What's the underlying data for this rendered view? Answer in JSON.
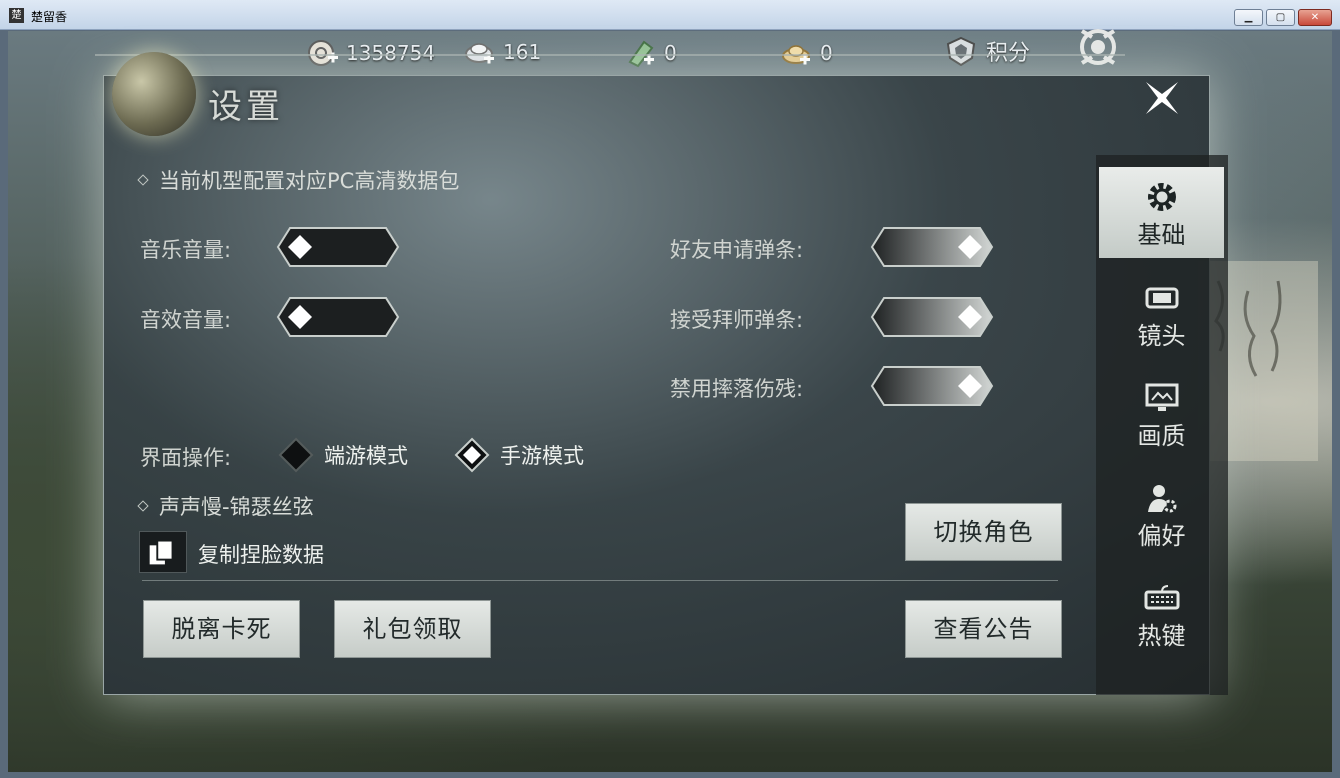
{
  "window": {
    "title": "楚留香",
    "icon_glyph": "楚",
    "min_glyph": "▁",
    "max_glyph": "▢",
    "close_glyph": "✕"
  },
  "hud": {
    "coins": "1358754",
    "silver": "161",
    "jade": "0",
    "ingot": "0",
    "points_label": "积分"
  },
  "settings": {
    "title": "设置",
    "hd_pack_label": "当前机型配置对应PC高清数据包",
    "music_volume_label": "音乐音量:",
    "sfx_volume_label": "音效音量:",
    "friend_request_label": "好友申请弹条:",
    "mentor_request_label": "接受拜师弹条:",
    "disable_fall_damage_label": "禁用摔落伤残:",
    "music_volume_level": 0,
    "sfx_volume_level": 0,
    "friend_request_enabled": true,
    "mentor_request_enabled": true,
    "disable_fall_damage_enabled": true,
    "ui_mode_label": "界面操作:",
    "ui_modes": [
      "端游模式",
      "手游模式"
    ],
    "ui_mode_selected": "手游模式",
    "character_label": "声声慢-锦瑟丝弦",
    "copy_face_label": "复制捏脸数据",
    "switch_role_button": "切换角色",
    "unstuck_button": "脱离卡死",
    "gift_button": "礼包领取",
    "notice_button": "查看公告"
  },
  "tabs": [
    {
      "label": "基础",
      "icon": "gear-icon",
      "active": true
    },
    {
      "label": "镜头",
      "icon": "camera-icon",
      "active": false
    },
    {
      "label": "画质",
      "icon": "monitor-icon",
      "active": false
    },
    {
      "label": "偏好",
      "icon": "user-settings-icon",
      "active": false
    },
    {
      "label": "热键",
      "icon": "keyboard-icon",
      "active": false
    }
  ],
  "colors": {
    "panel_bg": "#374246",
    "button_bg": "#dde2df",
    "active_tab": "#dfe4e1"
  }
}
